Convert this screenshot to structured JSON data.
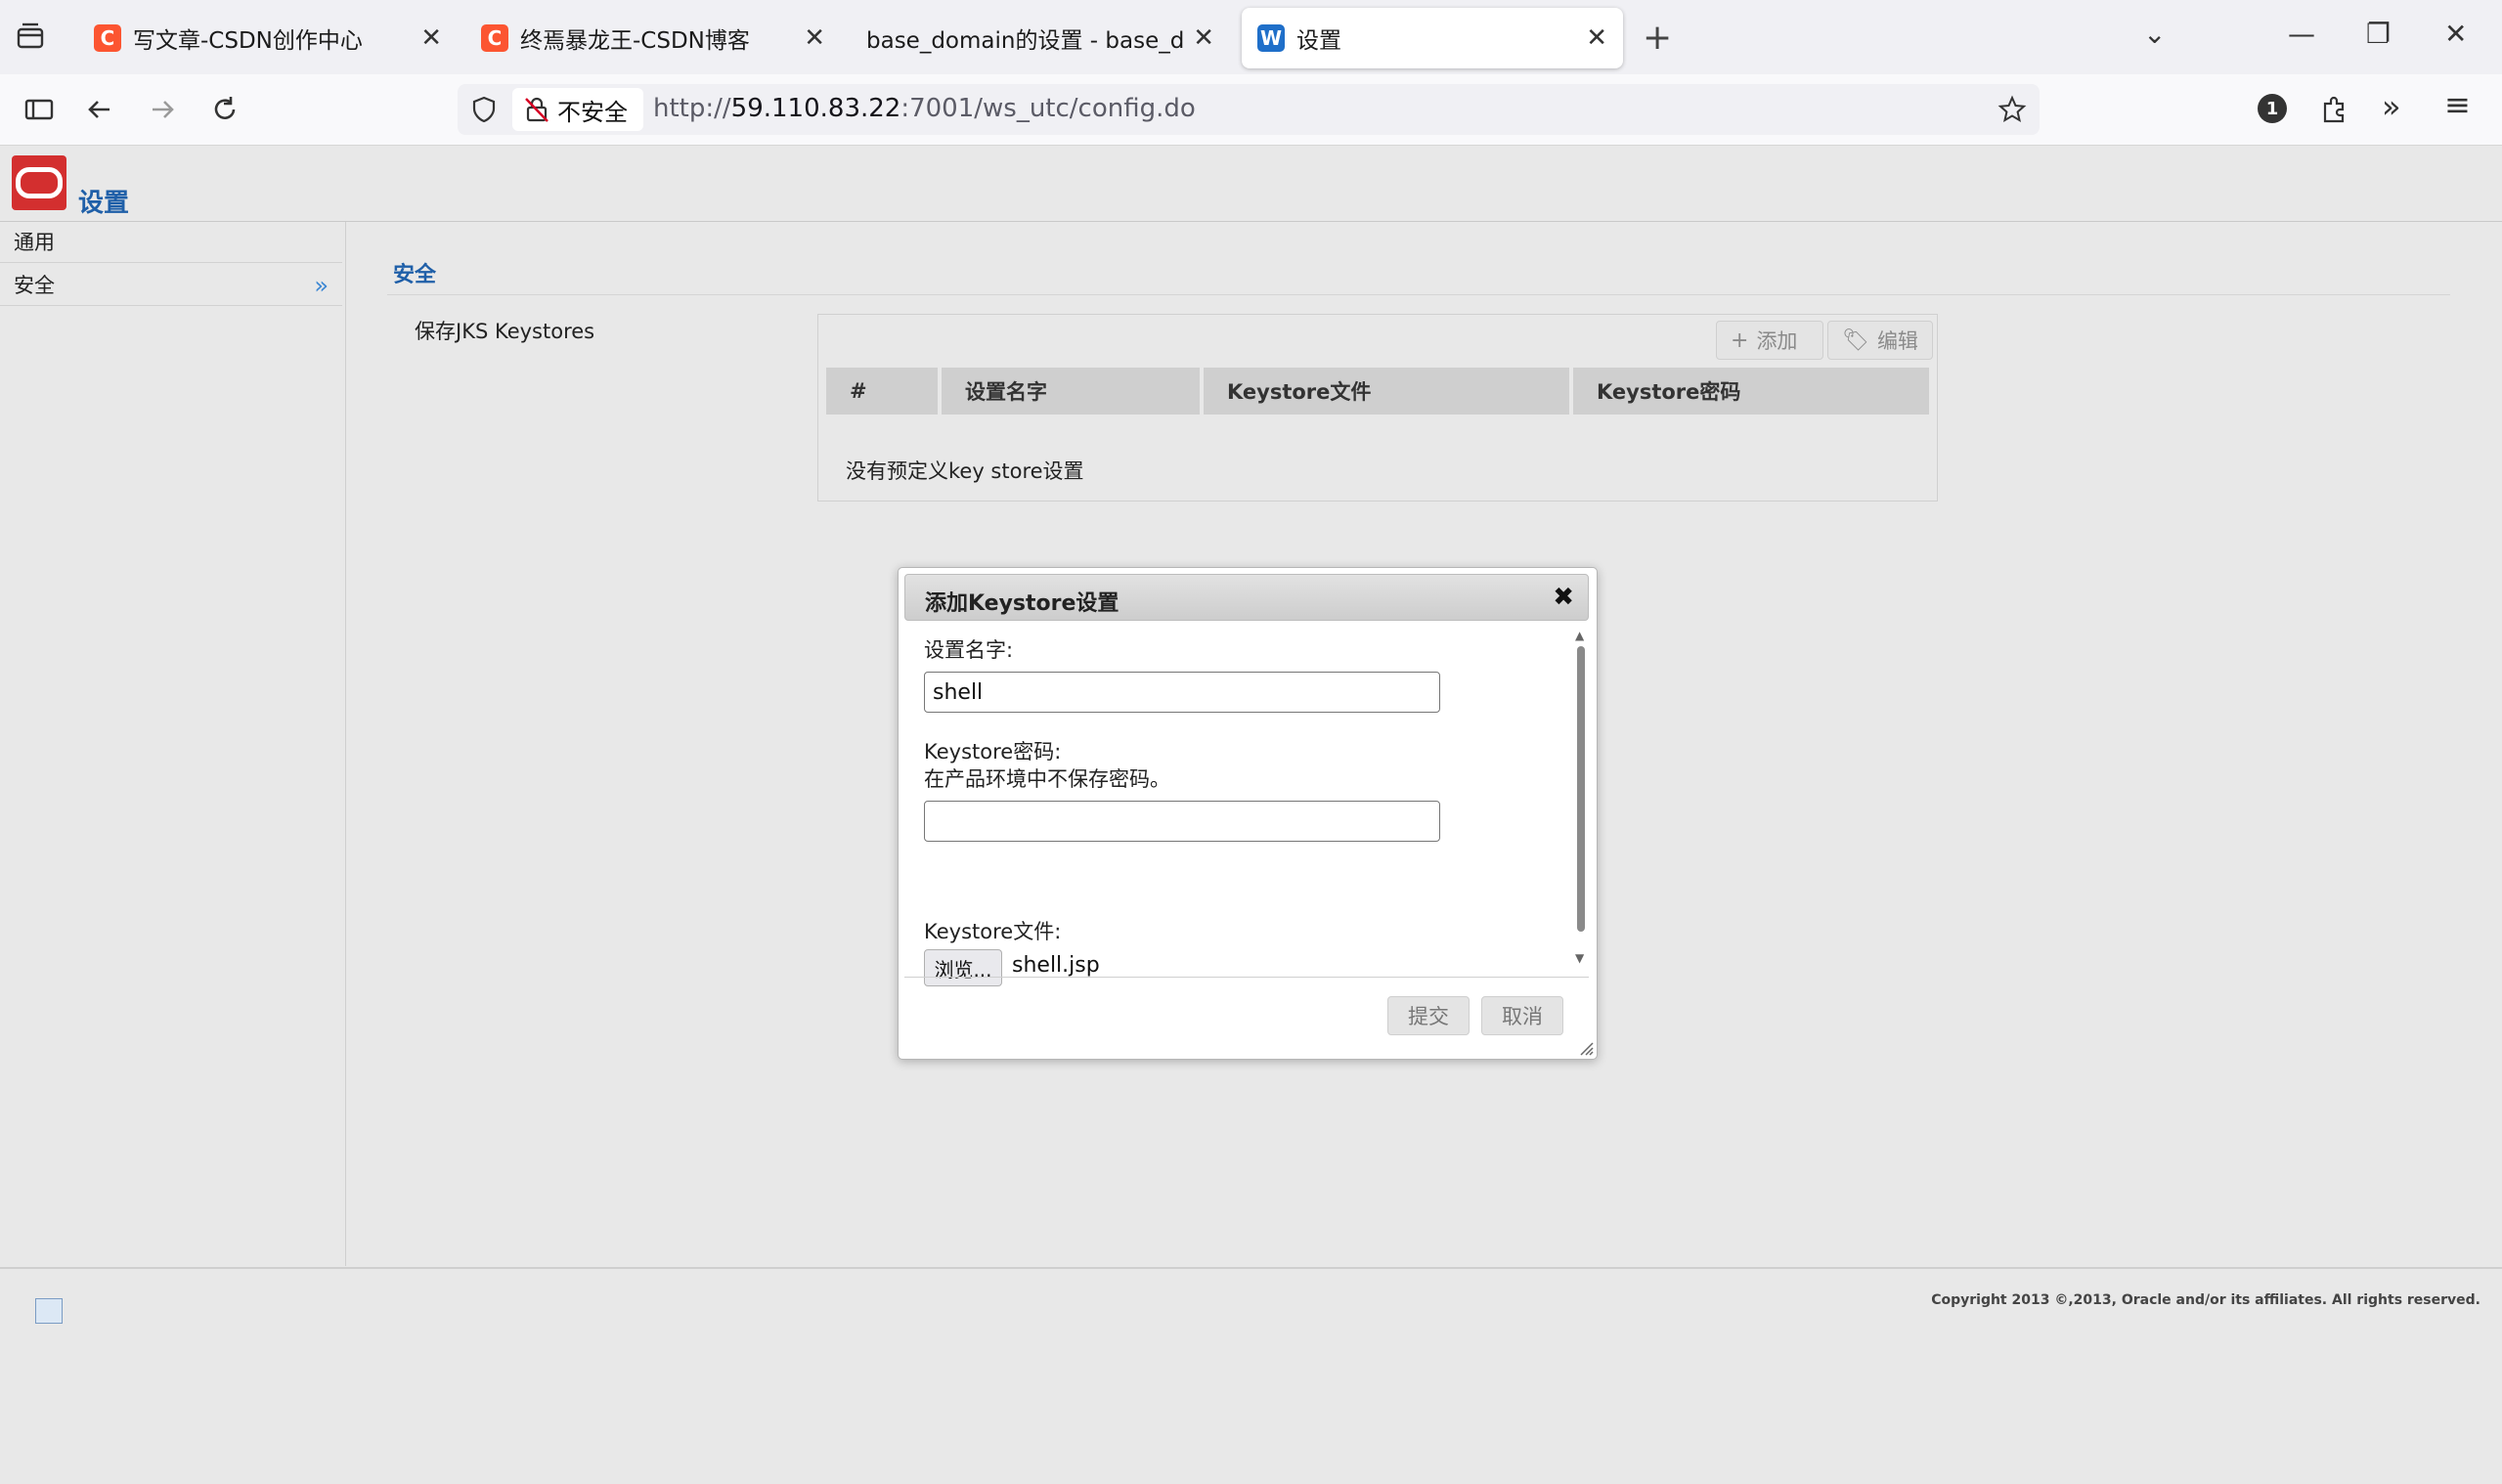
{
  "browser": {
    "tabs": [
      {
        "title": "写文章-CSDN创作中心",
        "favicon": "C"
      },
      {
        "title": "终焉暴龙王-CSDN博客",
        "favicon": "C"
      },
      {
        "title": "base_domain的设置 - base_doma",
        "favicon": ""
      },
      {
        "title": "设置",
        "favicon": "W"
      }
    ],
    "security_label": "不安全",
    "url_prefix": "http://",
    "url_host": "59.110.83.22",
    "url_rest": ":7001/ws_utc/config.do",
    "notification_count": "1"
  },
  "page": {
    "title": "设置",
    "brand_color": "#d32f2f",
    "accent_color": "#1f5fa8"
  },
  "sidebar": {
    "items": [
      {
        "label": "通用"
      },
      {
        "label": "安全"
      }
    ]
  },
  "content": {
    "section_title": "安全",
    "keystores_label": "保存JKS Keystores",
    "add_label": "添加",
    "edit_label": "编辑",
    "table_headers": [
      "#",
      "设置名字",
      "Keystore文件",
      "Keystore密码"
    ],
    "empty_message": "没有预定义key store设置"
  },
  "dialog": {
    "title": "添加Keystore设置",
    "name_label": "设置名字:",
    "name_value": "shell",
    "password_label": "Keystore密码:",
    "password_hint": "在产品环境中不保存密码。",
    "password_value": "",
    "file_label": "Keystore文件:",
    "browse_label": "浏览...",
    "file_name": "shell.jsp",
    "submit_label": "提交",
    "cancel_label": "取消"
  },
  "footer": {
    "copyright": "Copyright 2013 ©,2013, Oracle and/or its affiliates. All rights reserved."
  }
}
